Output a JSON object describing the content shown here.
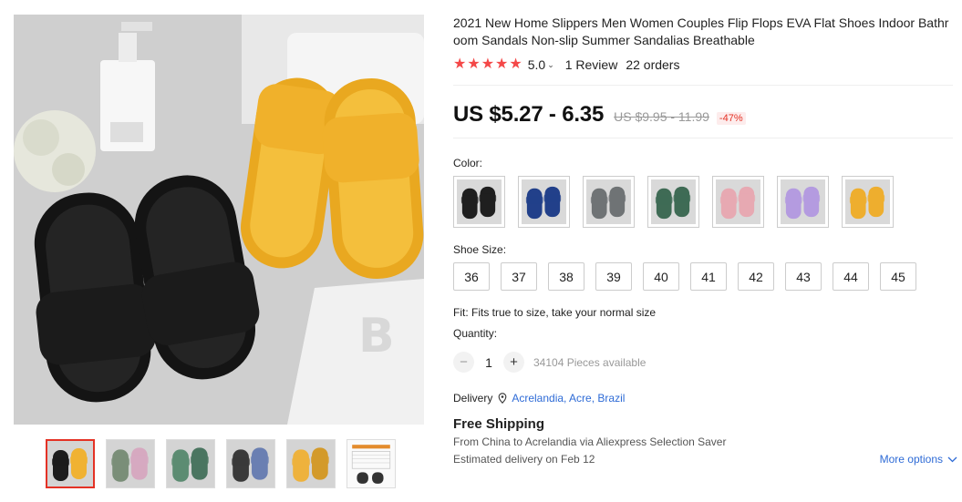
{
  "product": {
    "title": "2021 New Home Slippers Men Women Couples Flip Flops EVA Flat Shoes Indoor Bathroom Sandals Non-slip Summer Sandalias Breathable",
    "rating": "5.0",
    "reviews": "1 Review",
    "orders": "22 orders",
    "price": "US $5.27 - 6.35",
    "original_price": "US $9.95 - 11.99",
    "discount": "-47%"
  },
  "gallery": {
    "main_overlay_letter": "B",
    "thumbnails": [
      {
        "name": "black-yellow",
        "colors": [
          "#1c1c1c",
          "#f0b232"
        ]
      },
      {
        "name": "pastel-set",
        "colors": [
          "#7a8e78",
          "#d6a9c0"
        ]
      },
      {
        "name": "green",
        "colors": [
          "#5c8c72",
          "#4a7560"
        ]
      },
      {
        "name": "mixed",
        "colors": [
          "#3a3a3a",
          "#6a7fb2"
        ]
      },
      {
        "name": "yellow-pair",
        "colors": [
          "#eeb23d",
          "#d39a2a"
        ]
      },
      {
        "name": "size-chart",
        "colors": [
          "#f2f2f2",
          "#333333"
        ]
      }
    ]
  },
  "color": {
    "label": "Color:",
    "options": [
      {
        "name": "black",
        "hex": "#1f1f1f"
      },
      {
        "name": "blue",
        "hex": "#22408a"
      },
      {
        "name": "gray",
        "hex": "#6f7375"
      },
      {
        "name": "green",
        "hex": "#3f6b55"
      },
      {
        "name": "pink",
        "hex": "#e7a9b2"
      },
      {
        "name": "purple",
        "hex": "#b49be0"
      },
      {
        "name": "yellow",
        "hex": "#eeae2e"
      }
    ]
  },
  "size": {
    "label": "Shoe Size:",
    "options": [
      "36",
      "37",
      "38",
      "39",
      "40",
      "41",
      "42",
      "43",
      "44",
      "45"
    ]
  },
  "fit": "Fit: Fits true to size, take your normal size",
  "quantity": {
    "label": "Quantity:",
    "minus": "−",
    "plus": "+",
    "value": "1",
    "available": "34104 Pieces available"
  },
  "delivery": {
    "label": "Delivery",
    "location": "Acrelandia, Acre, Brazil",
    "icon": "location-pin-icon"
  },
  "shipping": {
    "title": "Free Shipping",
    "from_text": "From China to Acrelandia via Aliexpress Selection Saver",
    "estimate": "Estimated delivery on Feb 12",
    "more_options": "More options"
  },
  "colors": {
    "star": "#f44848",
    "link": "#2e6bd6",
    "discount": "#e43225"
  }
}
